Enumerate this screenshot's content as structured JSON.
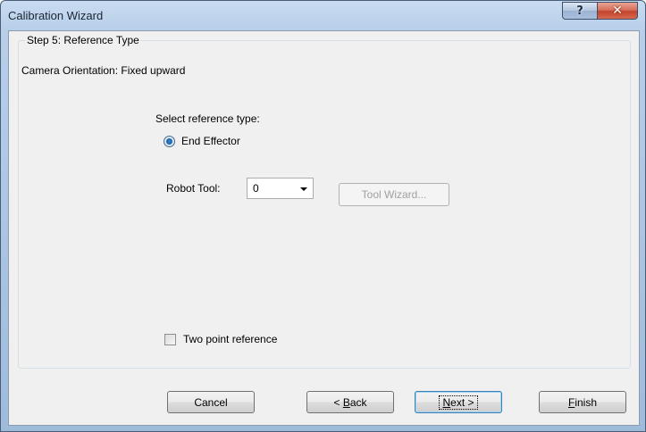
{
  "window": {
    "title": "Calibration Wizard",
    "help_glyph": "?",
    "close_glyph": "✕"
  },
  "step": {
    "legend": "Step 5: Reference Type",
    "camera_orientation": "Camera Orientation: Fixed upward",
    "select_label": "Select reference type:",
    "radio_option": "End Effector",
    "robot_tool_label": "Robot Tool:",
    "robot_tool_value": "0",
    "tool_wizard_button": "Tool Wizard...",
    "two_point_label": "Two point reference",
    "two_point_checked": false
  },
  "buttons": {
    "cancel": "Cancel",
    "back_prefix": "< ",
    "back_mnemonic": "B",
    "back_rest": "ack",
    "next_mnemonic": "N",
    "next_rest": "ext >",
    "finish_mnemonic": "F",
    "finish_rest": "inish"
  },
  "colors": {
    "accent": "#1a5fa4",
    "close_button": "#c3432b"
  }
}
